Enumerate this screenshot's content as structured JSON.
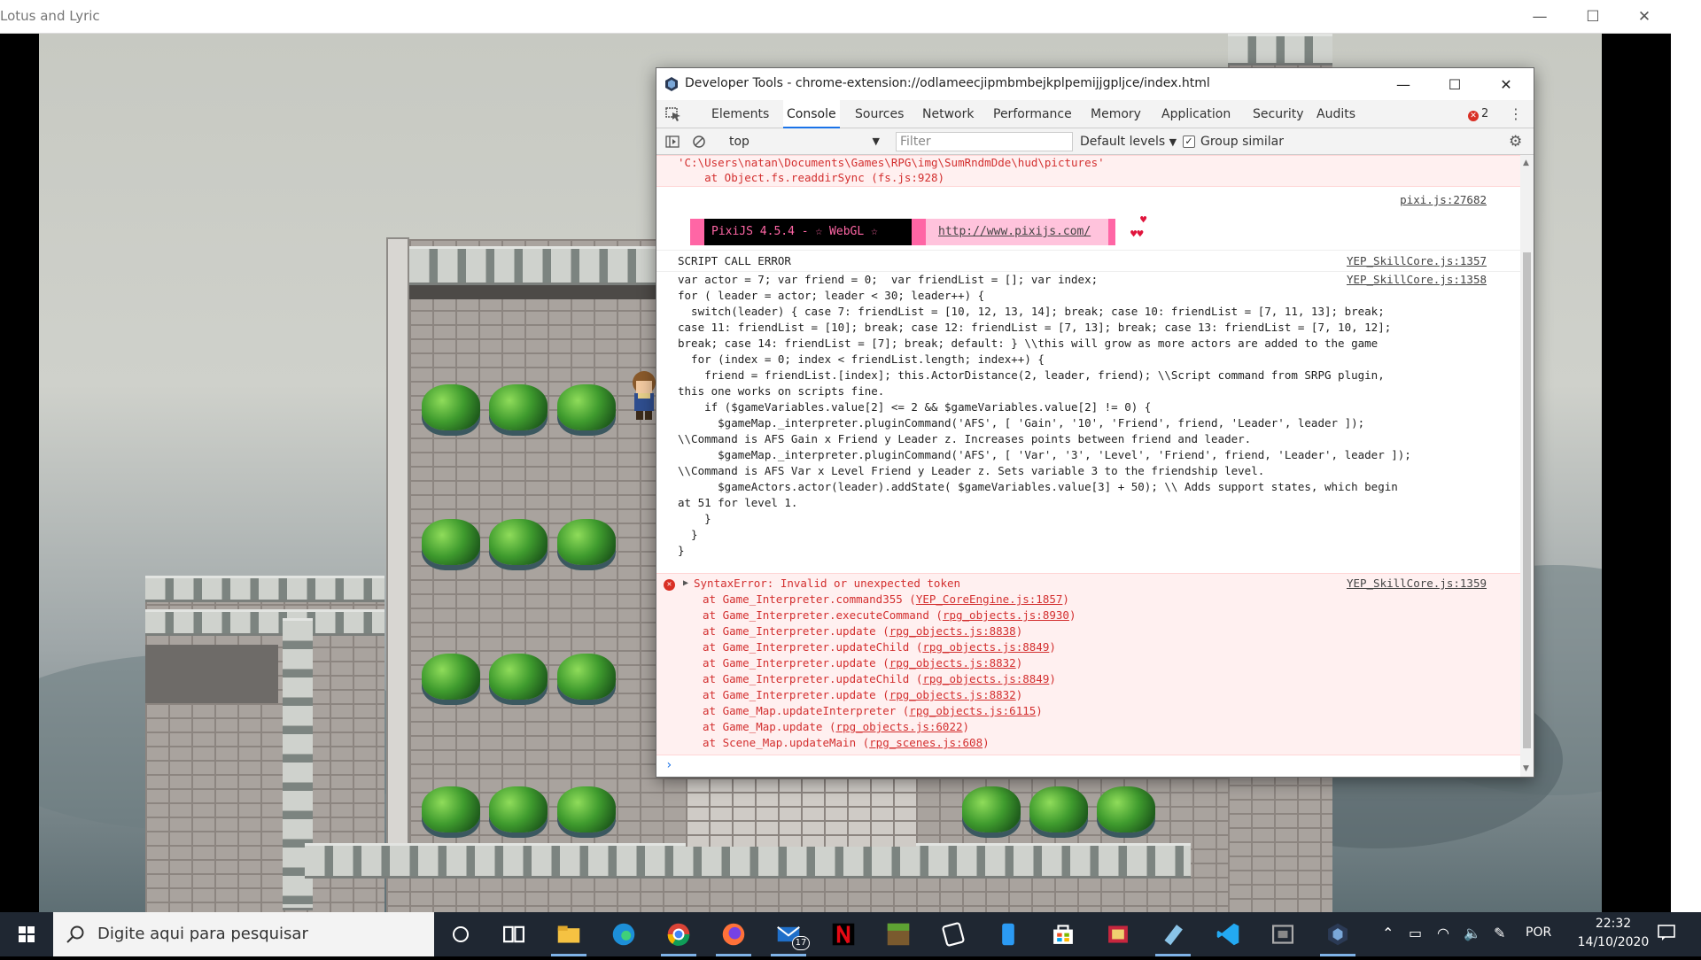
{
  "game_window": {
    "title": "Lotus and Lyric",
    "controls": {
      "minimize": "—",
      "maximize": "☐",
      "close": "✕"
    }
  },
  "devtools": {
    "title": "Developer Tools - chrome-extension://odlameecjipmbmbejkplpemijjgpljce/index.html",
    "controls": {
      "minimize": "—",
      "maximize": "☐",
      "close": "✕"
    },
    "tabs": [
      {
        "label": "Elements"
      },
      {
        "label": "Console"
      },
      {
        "label": "Sources"
      },
      {
        "label": "Network"
      },
      {
        "label": "Performance"
      },
      {
        "label": "Memory"
      },
      {
        "label": "Application"
      },
      {
        "label": "Security"
      },
      {
        "label": "Audits"
      }
    ],
    "active_tab": "Console",
    "error_count": "2",
    "toolbar": {
      "context": "top",
      "filter_placeholder": "Filter",
      "levels": "Default levels",
      "group_similar": "Group similar",
      "group_similar_checked": true
    },
    "console": {
      "top_error": {
        "lines": [
          "'C:\\Users\\natan\\Documents\\Games\\RPG\\img\\SumRndmDde\\hud\\pictures'",
          "    at Object.fs.readdirSync (fs.js:928)"
        ]
      },
      "pixi": {
        "source": "pixi.js:27682",
        "badge": "PixiJS 4.5.4 - ☆ WebGL ☆",
        "url": "http://www.pixijs.com/",
        "hearts": "♥♥"
      },
      "script_call_error": {
        "text": "SCRIPT CALL ERROR",
        "source": "YEP_SkillCore.js:1357"
      },
      "script_body": {
        "source": "YEP_SkillCore.js:1358",
        "lines": [
          "var actor = 7; var friend = 0;  var friendList = []; var index;",
          "for ( leader = actor; leader < 30; leader++) {",
          "  switch(leader) { case 7: friendList = [10, 12, 13, 14]; break; case 10: friendList = [7, 11, 13]; break;",
          "case 11: friendList = [10]; break; case 12: friendList = [7, 13]; break; case 13: friendList = [7, 10, 12];",
          "break; case 14: friendList = [7]; break; default: } \\\\this will grow as more actors are added to the game",
          "  for (index = 0; index < friendList.length; index++) {",
          "    friend = friendList.[index]; this.ActorDistance(2, leader, friend); \\\\Script command from SRPG plugin,",
          "this one works on scripts fine.",
          "    if ($gameVariables.value[2] <= 2 && $gameVariables.value[2] != 0) {",
          "      $gameMap._interpreter.pluginCommand('AFS', [ 'Gain', '10', 'Friend', friend, 'Leader', leader ]);",
          "\\\\Command is AFS Gain x Friend y Leader z. Increases points between friend and leader.",
          "      $gameMap._interpreter.pluginCommand('AFS', [ 'Var', '3', 'Level', 'Friend', friend, 'Leader', leader ]);",
          "\\\\Command is AFS Var x Level Friend y Leader z. Sets variable 3 to the friendship level.",
          "      $gameActors.actor(leader).addState( $gameVariables.value[3] + 50); \\\\ Adds support states, which begin",
          "at 51 for level 1.",
          "    }",
          "  }",
          "}"
        ]
      },
      "syntax_error": {
        "message": "SyntaxError: Invalid or unexpected token",
        "source": "YEP_SkillCore.js:1359",
        "stack": [
          {
            "at": "at Game_Interpreter.command355 (",
            "file": "YEP_CoreEngine.js:1857",
            "end": ")"
          },
          {
            "at": "at Game_Interpreter.executeCommand (",
            "file": "rpg_objects.js:8930",
            "end": ")"
          },
          {
            "at": "at Game_Interpreter.update (",
            "file": "rpg_objects.js:8838",
            "end": ")"
          },
          {
            "at": "at Game_Interpreter.updateChild (",
            "file": "rpg_objects.js:8849",
            "end": ")"
          },
          {
            "at": "at Game_Interpreter.update (",
            "file": "rpg_objects.js:8832",
            "end": ")"
          },
          {
            "at": "at Game_Interpreter.updateChild (",
            "file": "rpg_objects.js:8849",
            "end": ")"
          },
          {
            "at": "at Game_Interpreter.update (",
            "file": "rpg_objects.js:8832",
            "end": ")"
          },
          {
            "at": "at Game_Map.updateInterpreter (",
            "file": "rpg_objects.js:6115",
            "end": ")"
          },
          {
            "at": "at Game_Map.update (",
            "file": "rpg_objects.js:6022",
            "end": ")"
          },
          {
            "at": "at Scene_Map.updateMain (",
            "file": "rpg_scenes.js:608",
            "end": ")"
          }
        ]
      },
      "prompt": "›"
    }
  },
  "taskbar": {
    "search_placeholder": "Digite aqui para pesquisar",
    "mail_badge": "17",
    "language": "POR",
    "time": "22:32",
    "date": "14/10/2020",
    "apps": [
      {
        "icon": "task-view-icon"
      },
      {
        "icon": "file-explorer-icon"
      },
      {
        "icon": "edge-icon"
      },
      {
        "icon": "chrome-icon"
      },
      {
        "icon": "firefox-icon"
      },
      {
        "icon": "mail-icon"
      },
      {
        "icon": "netflix-icon"
      },
      {
        "icon": "minecraft-icon"
      },
      {
        "icon": "tablet-app-icon"
      },
      {
        "icon": "phone-app-icon"
      },
      {
        "icon": "store-icon"
      },
      {
        "icon": "rpg-maker-icon"
      },
      {
        "icon": "notes-app-icon"
      },
      {
        "icon": "vscode-icon"
      },
      {
        "icon": "game-app-icon"
      },
      {
        "icon": "nwjs-icon"
      }
    ]
  }
}
